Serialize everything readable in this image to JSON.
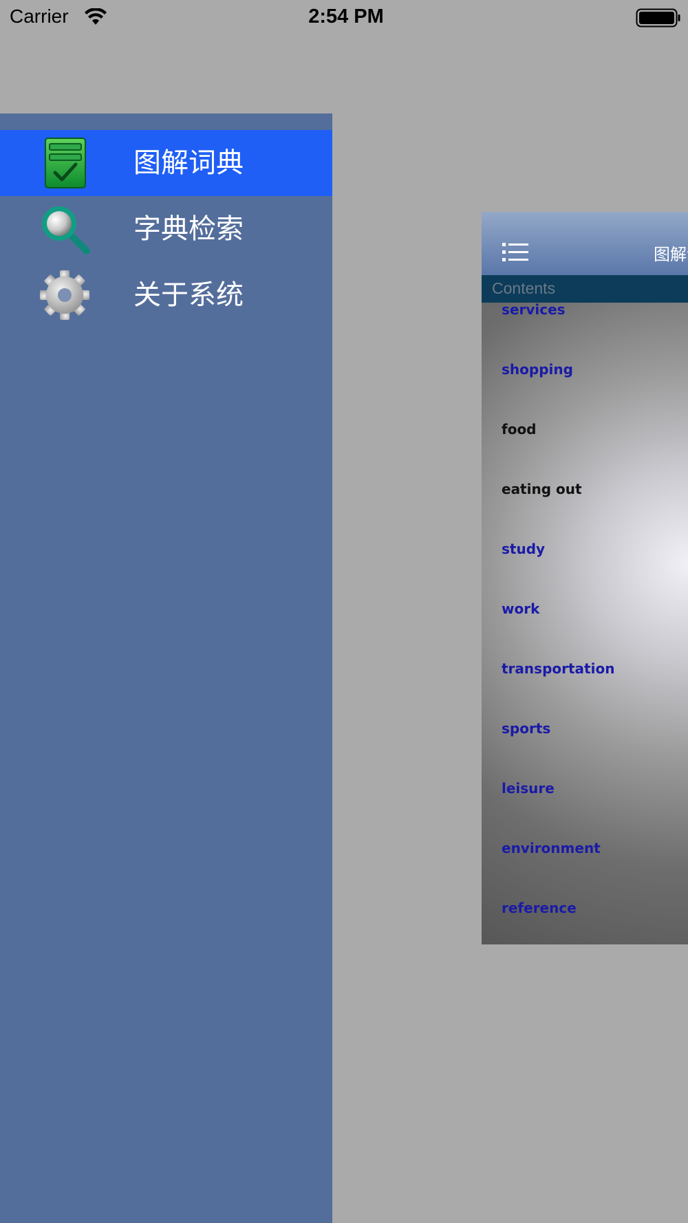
{
  "status_bar": {
    "carrier": "Carrier",
    "time": "2:54 PM"
  },
  "side_menu": {
    "items": [
      {
        "label": "图解词典",
        "icon": "green-checklist-icon",
        "selected": true
      },
      {
        "label": "字典检索",
        "icon": "magnifier-icon",
        "selected": false
      },
      {
        "label": "关于系统",
        "icon": "gear-icon",
        "selected": false
      }
    ]
  },
  "content": {
    "nav_title": "图解词典",
    "section_header": "Contents",
    "items": [
      {
        "label": "services",
        "color": "#1a1aa8"
      },
      {
        "label": "shopping",
        "color": "#1a1aa8"
      },
      {
        "label": "food",
        "color": "#111111"
      },
      {
        "label": "eating out",
        "color": "#111111"
      },
      {
        "label": "study",
        "color": "#1a1aa8"
      },
      {
        "label": "work",
        "color": "#1a1aa8"
      },
      {
        "label": "transportation",
        "color": "#1a1aa8"
      },
      {
        "label": "sports",
        "color": "#1a1aa8"
      },
      {
        "label": "leisure",
        "color": "#1a1aa8"
      },
      {
        "label": "environment",
        "color": "#1a1aa8"
      },
      {
        "label": "reference",
        "color": "#1a1aa8"
      }
    ]
  },
  "colors": {
    "background": "#aaaaaa",
    "side_menu": "#546e9b",
    "selected": "#1f5ff5",
    "section_header": "#0c3c5a"
  }
}
